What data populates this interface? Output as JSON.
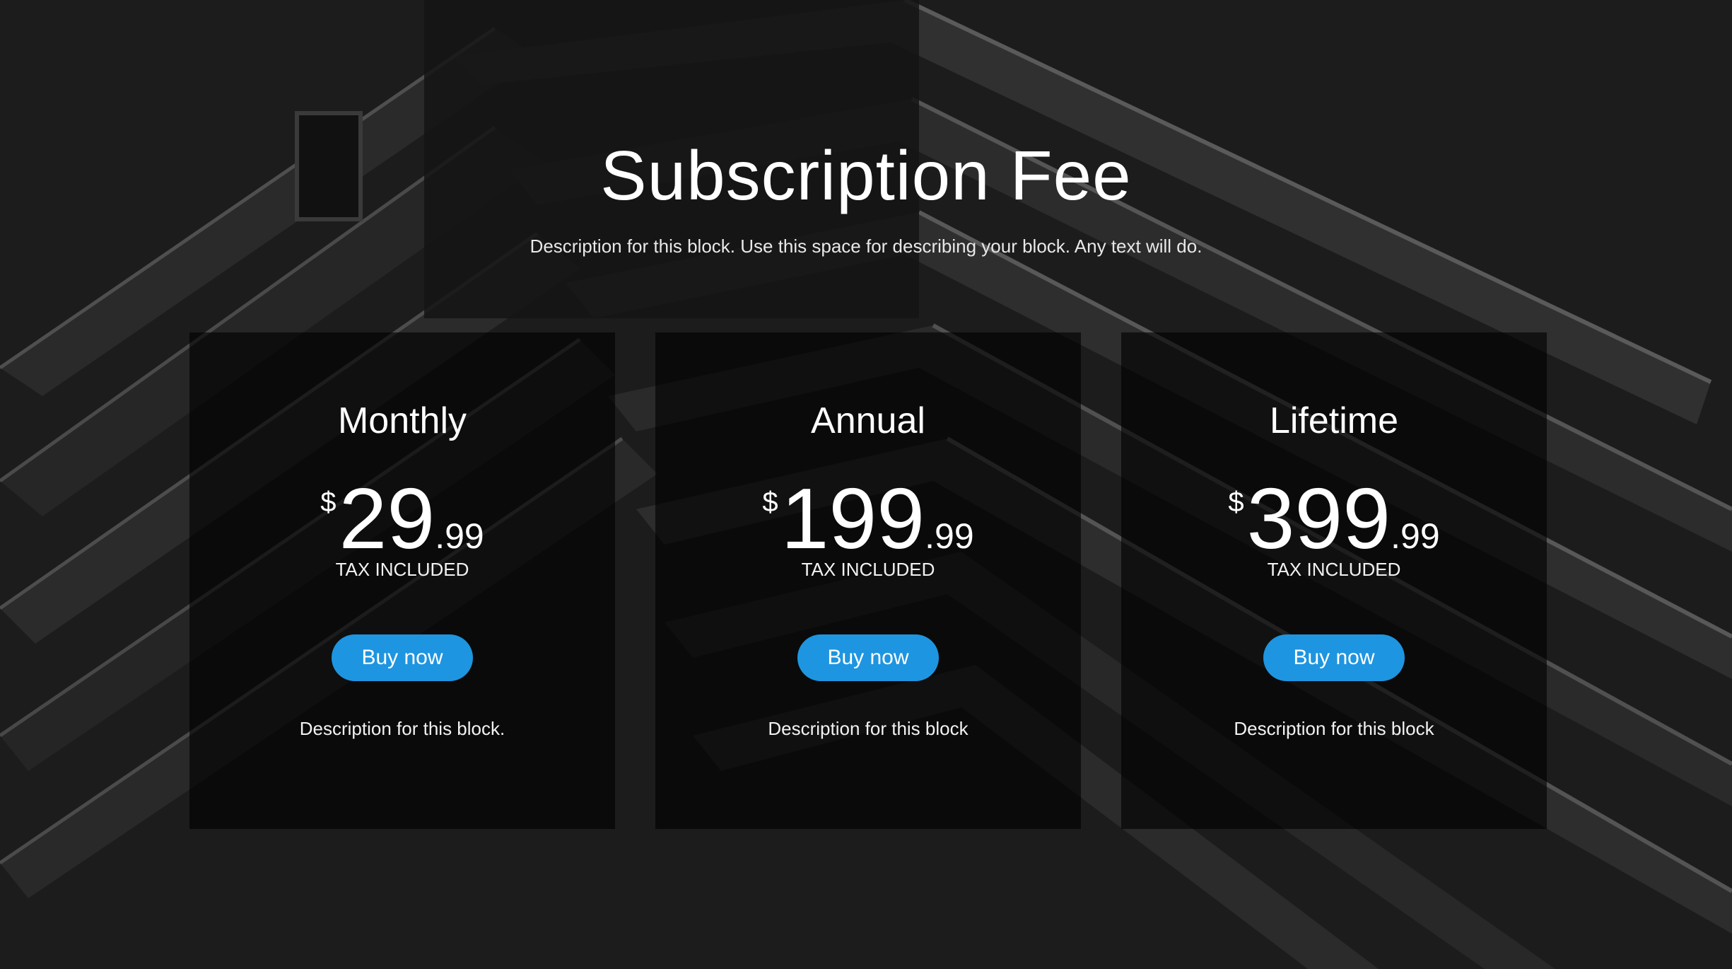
{
  "header": {
    "title": "Subscription Fee",
    "subtitle": "Description for this block. Use this space for describing your block. Any text will do."
  },
  "plans": [
    {
      "name": "Monthly",
      "currency": "$",
      "amount": "29",
      "cents": ".99",
      "tax": "TAX INCLUDED",
      "button": "Buy now",
      "description": "Description for this block."
    },
    {
      "name": "Annual",
      "currency": "$",
      "amount": "199",
      "cents": ".99",
      "tax": "TAX INCLUDED",
      "button": "Buy now",
      "description": "Description for this block"
    },
    {
      "name": "Lifetime",
      "currency": "$",
      "amount": "399",
      "cents": ".99",
      "tax": "TAX INCLUDED",
      "button": "Buy now",
      "description": "Description for this block"
    }
  ],
  "colors": {
    "button": "#1e95e0",
    "background": "#1a1a1a",
    "card": "rgba(0,0,0,0.62)"
  }
}
